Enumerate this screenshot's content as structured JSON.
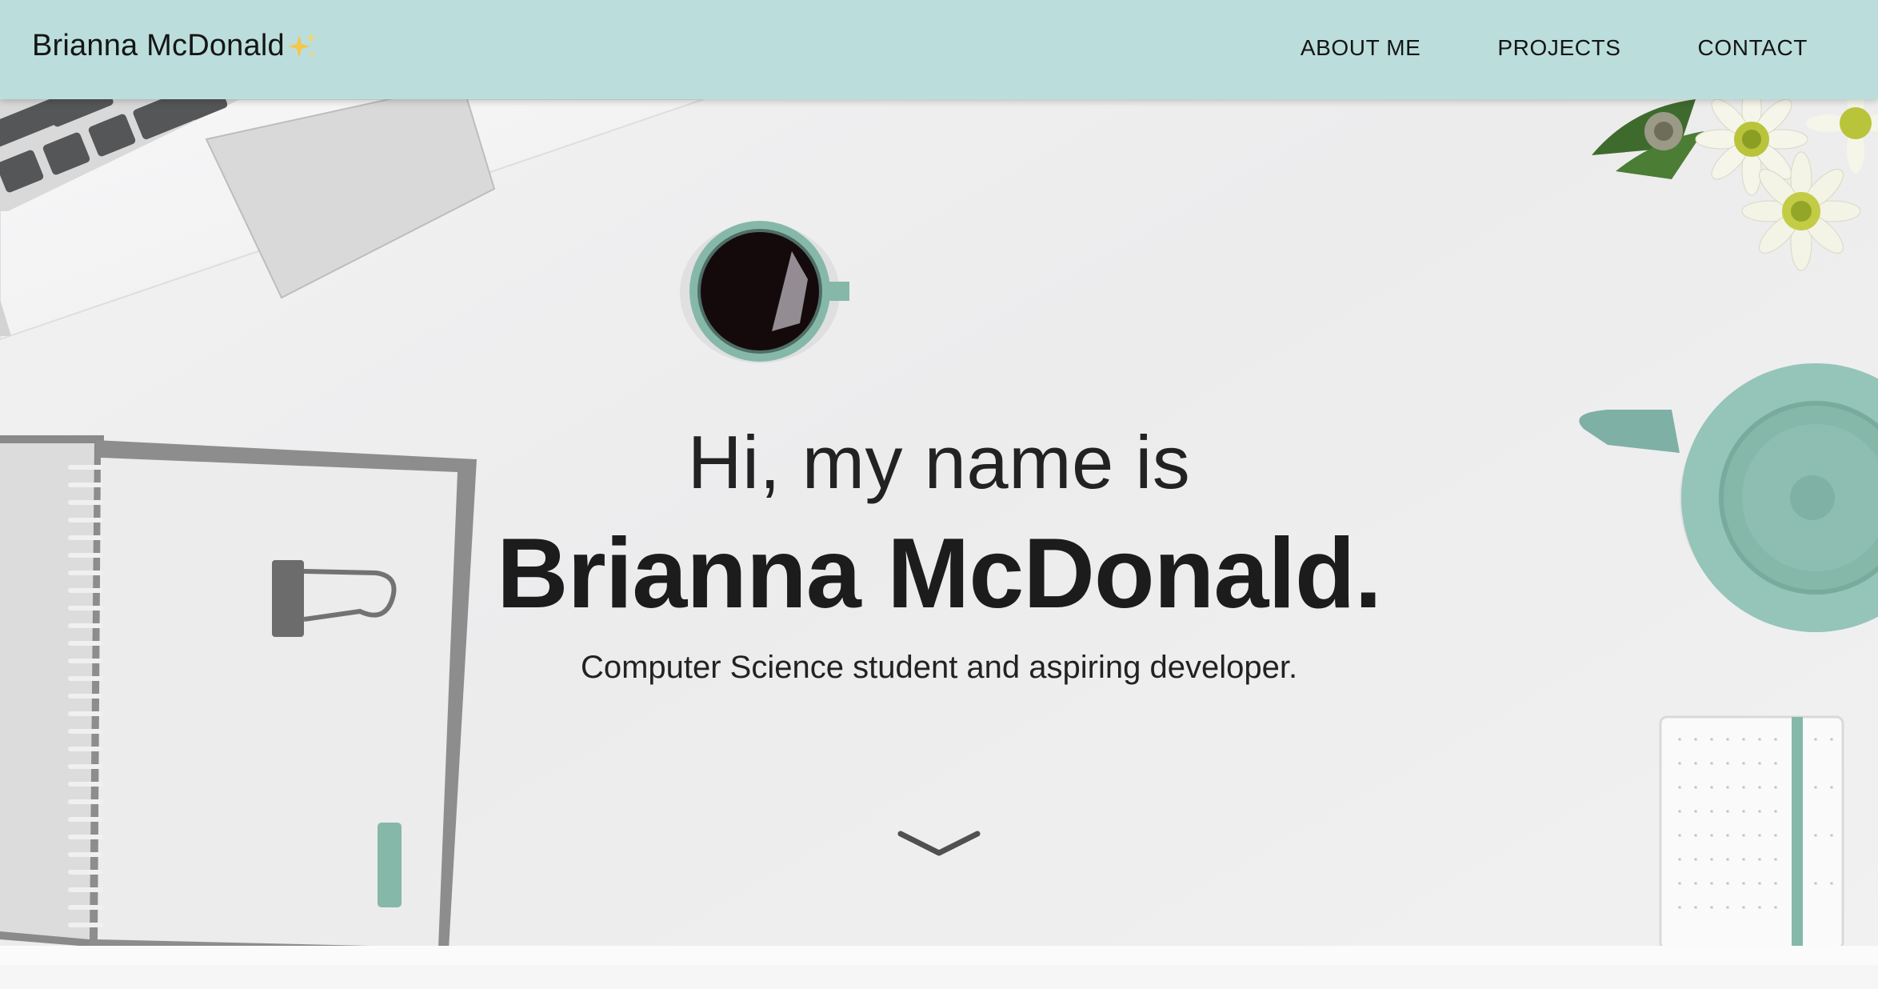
{
  "navbar": {
    "brand": "Brianna McDonald",
    "brand_icon": "sparkles-icon",
    "links": [
      {
        "label": "ABOUT ME"
      },
      {
        "label": "PROJECTS"
      },
      {
        "label": "CONTACT"
      }
    ]
  },
  "hero": {
    "greeting": "Hi, my name is",
    "name": "Brianna McDonald.",
    "tagline": "Computer Science student and aspiring developer.",
    "scroll_icon": "chevron-down-icon"
  },
  "colors": {
    "navbar_bg": "#bbdedc",
    "accent_mint": "#86b8aa",
    "text": "#1f1f1f"
  }
}
